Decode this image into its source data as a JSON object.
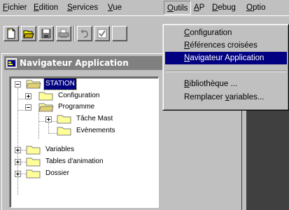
{
  "menubar": {
    "items": [
      {
        "u": "F",
        "rest": "ichier"
      },
      {
        "u": "E",
        "rest": "dition"
      },
      {
        "u": "S",
        "rest": "ervices"
      },
      {
        "u": "V",
        "rest": "ue"
      },
      {
        "u": "O",
        "rest": "utils"
      },
      {
        "u": "A",
        "rest": "P"
      },
      {
        "u": "D",
        "rest": "ebug"
      },
      {
        "u": "O",
        "rest": "ptio"
      }
    ]
  },
  "navigator": {
    "title": "Navigateur Application"
  },
  "tree": {
    "items": [
      "STATION",
      "Configuration",
      "Programme",
      "Tâche Mast",
      "Evènements",
      "Variables",
      "Tables d'animation",
      "Dossier"
    ]
  },
  "outils_menu": {
    "items": [
      {
        "u": "C",
        "rest": "onfiguration"
      },
      {
        "u": "R",
        "rest": "éférences croisées"
      },
      {
        "u": "N",
        "rest": "avigateur Application"
      },
      {
        "u": "B",
        "rest": "ibliothèque ..."
      },
      {
        "pre": "Remplacer ",
        "u": "v",
        "rest": "ariables..."
      }
    ]
  },
  "colors": {
    "face": "#c0c0c0",
    "selection": "#000080",
    "folder": "#ffff99",
    "dark_area": "#404040"
  }
}
